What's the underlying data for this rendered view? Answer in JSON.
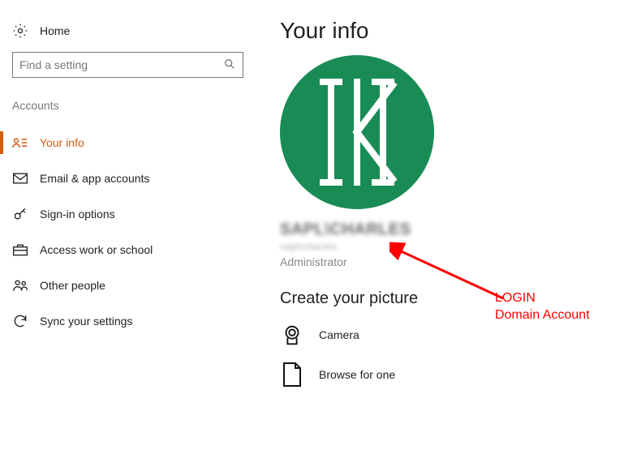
{
  "sidebar": {
    "home_label": "Home",
    "search_placeholder": "Find a setting",
    "section_label": "Accounts",
    "items": [
      {
        "label": "Your info"
      },
      {
        "label": "Email & app accounts"
      },
      {
        "label": "Sign-in options"
      },
      {
        "label": "Access work or school"
      },
      {
        "label": "Other people"
      },
      {
        "label": "Sync your settings"
      }
    ]
  },
  "main": {
    "title": "Your info",
    "username_blurred": "SAPL\\CHARLES",
    "subline_blurred": "sapl\\charles",
    "role": "Administrator",
    "create_picture_heading": "Create your picture",
    "camera_label": "Camera",
    "browse_label": "Browse for one"
  },
  "annotation": {
    "line1": "LOGIN",
    "line2": "Domain Account"
  },
  "colors": {
    "accent": "#d45b0f",
    "avatar_bg": "#198c55",
    "annotation": "#ff0000"
  }
}
